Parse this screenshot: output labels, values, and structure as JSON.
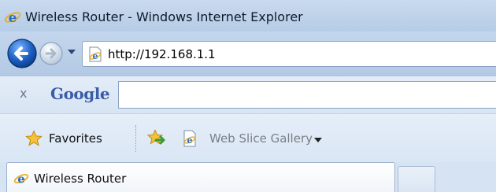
{
  "window": {
    "title": "Wireless Router - Windows Internet Explorer"
  },
  "nav": {
    "address": "http://192.168.1.1"
  },
  "google_toolbar": {
    "close_glyph": "x",
    "brand": "Google",
    "search_value": ""
  },
  "favorites_bar": {
    "favorites_label": "Favorites",
    "web_slice_label": "Web Slice Gallery"
  },
  "tabs": [
    {
      "label": "Wireless Router",
      "active": true
    }
  ],
  "icons": {
    "app": "internet-explorer-icon",
    "back": "back-arrow-icon",
    "forward": "forward-arrow-icon",
    "history": "chevron-down-icon",
    "page": "internet-explorer-page-icon",
    "favorites": "star-icon",
    "add_favorite": "add-favorite-icon",
    "web_slice": "internet-explorer-page-icon"
  },
  "colors": {
    "chrome": "#d6e3f2",
    "accent": "#3b5da8",
    "back_button": "#1f63c6"
  }
}
